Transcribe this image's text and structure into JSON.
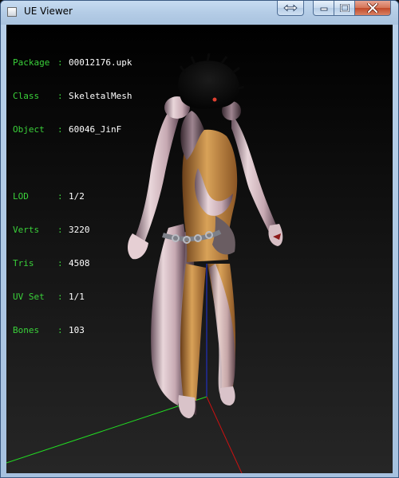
{
  "window": {
    "title": "UE Viewer",
    "buttons": {
      "swap_icon": "swap-arrows-icon",
      "minimize_icon": "minimize-icon",
      "maximize_icon": "maximize-icon",
      "close_icon": "close-icon"
    }
  },
  "info": {
    "package": {
      "label": "Package",
      "value": "00012176.upk"
    },
    "class": {
      "label": "Class",
      "value": "SkeletalMesh"
    },
    "object": {
      "label": "Object",
      "value": "60046_JinF"
    },
    "lod": {
      "label": "LOD",
      "value": "1/2"
    },
    "verts": {
      "label": "Verts",
      "value": "3220"
    },
    "tris": {
      "label": "Tris",
      "value": "4508"
    },
    "uvset": {
      "label": "UV Set",
      "value": "1/1"
    },
    "bones": {
      "label": "Bones",
      "value": "103"
    }
  },
  "colors": {
    "label_green": "#3ad13a",
    "axis_x": "#cc1111",
    "axis_y": "#22dd22",
    "axis_z": "#2233dd"
  }
}
